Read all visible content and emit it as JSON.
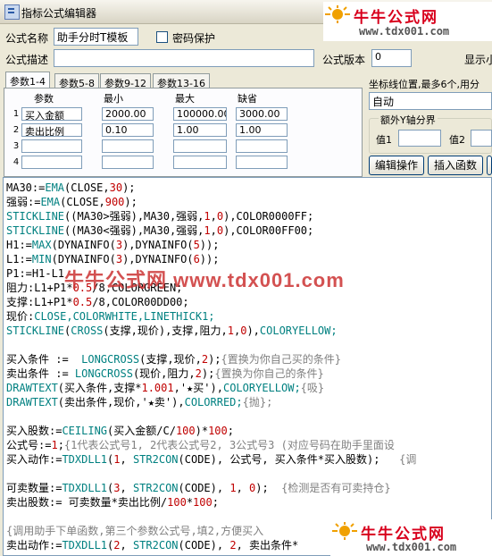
{
  "window": {
    "title": "指标公式编辑器"
  },
  "header": {
    "name_label": "公式名称",
    "name_value": "助手分时T模板",
    "password_label": "密码保护",
    "desc_label": "公式描述",
    "desc_value": "",
    "version_label": "公式版本",
    "version_value": "0",
    "display_label": "显示小"
  },
  "tabs": [
    {
      "label": "参数1-4"
    },
    {
      "label": "参数5-8"
    },
    {
      "label": "参数9-12"
    },
    {
      "label": "参数13-16"
    }
  ],
  "param_table": {
    "headers": [
      "参数",
      "最小",
      "最大",
      "缺省"
    ],
    "rows": [
      {
        "num": "1",
        "name": "买入金额",
        "min": "2000.00",
        "max": "100000.00",
        "default": "3000.00"
      },
      {
        "num": "2",
        "name": "卖出比例",
        "min": "0.10",
        "max": "1.00",
        "default": "1.00"
      },
      {
        "num": "3",
        "name": "",
        "min": "",
        "max": "",
        "default": ""
      },
      {
        "num": "4",
        "name": "",
        "min": "",
        "max": "",
        "default": ""
      }
    ]
  },
  "right_panel": {
    "axis_label": "坐标线位置,最多6个,用分",
    "axis_value": "自动",
    "extra_axis_label": "额外Y轴分界",
    "val1_label": "值1",
    "val2_label": "值2",
    "edit_button": "编辑操作",
    "insert_button": "插入函数"
  },
  "logo": {
    "brand": "牛牛公式网",
    "url": "www.tdx001.com"
  },
  "watermark": "牛牛公式网 www.tdx001.com",
  "code_lines": [
    [
      [
        "MA30:=",
        "id"
      ],
      [
        "EMA",
        "fn"
      ],
      [
        "(CLOSE,",
        "id"
      ],
      [
        "30",
        "num"
      ],
      [
        ");",
        "id"
      ]
    ],
    [
      [
        "强弱:=",
        "id"
      ],
      [
        "EMA",
        "fn"
      ],
      [
        "(CLOSE,",
        "id"
      ],
      [
        "900",
        "num"
      ],
      [
        ");",
        "id"
      ]
    ],
    [
      [
        "STICKLINE",
        "fn"
      ],
      [
        "((MA30>强弱),MA30,强弱,",
        "id"
      ],
      [
        "1",
        "num"
      ],
      [
        ",",
        "id"
      ],
      [
        "0",
        "num"
      ],
      [
        "),COLOR0000FF;",
        "id"
      ]
    ],
    [
      [
        "STICKLINE",
        "fn"
      ],
      [
        "((MA30<强弱),MA30,强弱,",
        "id"
      ],
      [
        "1",
        "num"
      ],
      [
        ",",
        "id"
      ],
      [
        "0",
        "num"
      ],
      [
        "),COLOR00FF00;",
        "id"
      ]
    ],
    [
      [
        "H1:=",
        "id"
      ],
      [
        "MAX",
        "fn"
      ],
      [
        "(DYNAINFO(",
        "id"
      ],
      [
        "3",
        "num"
      ],
      [
        "),DYNAINFO(",
        "id"
      ],
      [
        "5",
        "num"
      ],
      [
        "));",
        "id"
      ]
    ],
    [
      [
        "L1:=",
        "id"
      ],
      [
        "MIN",
        "fn"
      ],
      [
        "(DYNAINFO(",
        "id"
      ],
      [
        "3",
        "num"
      ],
      [
        "),DYNAINFO(",
        "id"
      ],
      [
        "6",
        "num"
      ],
      [
        "));",
        "id"
      ]
    ],
    [
      [
        "P1:=H1-L1",
        "id"
      ]
    ],
    [
      [
        "阻力:L1+P1*",
        "id"
      ],
      [
        "0.5",
        "num"
      ],
      [
        "/8,COLORGREEN;",
        "id"
      ]
    ],
    [
      [
        "支撑:L1+P1*",
        "id"
      ],
      [
        "0.5",
        "num"
      ],
      [
        "/8,COLOR00DD00;",
        "id"
      ]
    ],
    [
      [
        "现价:",
        "id"
      ],
      [
        "CLOSE,COLORWHITE,LINETHICK1;",
        "fn"
      ]
    ],
    [
      [
        "STICKLINE",
        "fn"
      ],
      [
        "(",
        "id"
      ],
      [
        "CROSS",
        "fn"
      ],
      [
        "(支撑,现价),支撑,阻力,",
        "id"
      ],
      [
        "1",
        "num"
      ],
      [
        ",",
        "id"
      ],
      [
        "0",
        "num"
      ],
      [
        "),",
        "id"
      ],
      [
        "COLORYELLOW;",
        "fn"
      ]
    ],
    [
      [
        "",
        ""
      ]
    ],
    [
      [
        "买入条件 :=  ",
        "id"
      ],
      [
        "LONGCROSS",
        "fn"
      ],
      [
        "(支撑,现价,",
        "id"
      ],
      [
        "2",
        "num"
      ],
      [
        ");",
        "id"
      ],
      [
        "{置换为你自己买的条件}",
        "cm"
      ]
    ],
    [
      [
        "卖出条件 := ",
        "id"
      ],
      [
        "LONGCROSS",
        "fn"
      ],
      [
        "(现价,阻力,",
        "id"
      ],
      [
        "2",
        "num"
      ],
      [
        ");",
        "id"
      ],
      [
        "{置换为你自己的条件}",
        "cm"
      ]
    ],
    [
      [
        "DRAWTEXT",
        "fn"
      ],
      [
        "(买入条件,支撑*",
        "id"
      ],
      [
        "1.001",
        "num"
      ],
      [
        ",'★买'),",
        "id"
      ],
      [
        "COLORYELLOW;",
        "fn"
      ],
      [
        "{吸}",
        "cm"
      ]
    ],
    [
      [
        "DRAWTEXT",
        "fn"
      ],
      [
        "(卖出条件,现价,'★卖'),",
        "id"
      ],
      [
        "COLORRED;",
        "fn"
      ],
      [
        "{抛};",
        "cm"
      ]
    ],
    [
      [
        "",
        ""
      ]
    ],
    [
      [
        "买入股数:=",
        "id"
      ],
      [
        "CEILING",
        "fn"
      ],
      [
        "(买入金额/C/",
        "id"
      ],
      [
        "100",
        "num"
      ],
      [
        ")*",
        "id"
      ],
      [
        "100",
        "num"
      ],
      [
        ";",
        "id"
      ]
    ],
    [
      [
        "公式号:=",
        "id"
      ],
      [
        "1",
        "num"
      ],
      [
        ";",
        "id"
      ],
      [
        "{1代表公式号1, 2代表公式号2, 3公式号3 (对应号码在助手里面设",
        "cm"
      ]
    ],
    [
      [
        "买入动作:=",
        "id"
      ],
      [
        "TDXDLL1",
        "fn"
      ],
      [
        "(",
        "id"
      ],
      [
        "1",
        "num"
      ],
      [
        ", ",
        "id"
      ],
      [
        "STR2CON",
        "fn"
      ],
      [
        "(CODE), 公式号, 买入条件*买入股数);   ",
        "id"
      ],
      [
        "{调",
        "cm"
      ]
    ],
    [
      [
        "",
        ""
      ]
    ],
    [
      [
        "可卖数量:=",
        "id"
      ],
      [
        "TDXDLL1",
        "fn"
      ],
      [
        "(",
        "id"
      ],
      [
        "3",
        "num"
      ],
      [
        ", ",
        "id"
      ],
      [
        "STR2CON",
        "fn"
      ],
      [
        "(CODE), ",
        "id"
      ],
      [
        "1",
        "num"
      ],
      [
        ", ",
        "id"
      ],
      [
        "0",
        "num"
      ],
      [
        ");  ",
        "id"
      ],
      [
        "{检测是否有可卖持仓}",
        "cm"
      ]
    ],
    [
      [
        "卖出股数:= 可卖数量*卖出比例/",
        "id"
      ],
      [
        "100",
        "num"
      ],
      [
        "*",
        "id"
      ],
      [
        "100",
        "num"
      ],
      [
        ";",
        "id"
      ]
    ],
    [
      [
        "",
        ""
      ]
    ],
    [
      [
        "{调用助手下单函数,第三个参数公式号,填2,方便买入",
        "cm"
      ]
    ],
    [
      [
        "卖出动作:=",
        "id"
      ],
      [
        "TDXDLL1",
        "fn"
      ],
      [
        "(",
        "id"
      ],
      [
        "2",
        "num"
      ],
      [
        ", ",
        "id"
      ],
      [
        "STR2CON",
        "fn"
      ],
      [
        "(CODE), ",
        "id"
      ],
      [
        "2",
        "num"
      ],
      [
        ", 卖出条件*",
        "id"
      ]
    ]
  ]
}
